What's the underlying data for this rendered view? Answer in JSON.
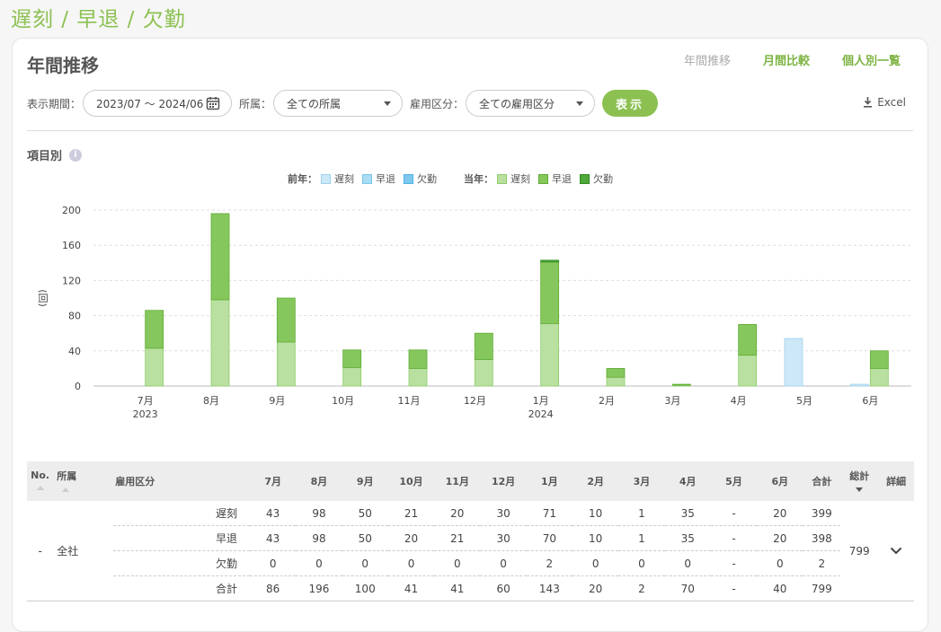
{
  "breadcrumb": "遅刻 / 早退 / 欠勤",
  "page_title": "年間推移",
  "view_tabs": [
    "年間推移",
    "月間比較",
    "個人別一覧"
  ],
  "filters": {
    "period_label": "表示期間：",
    "period_value": "2023/07 ～ 2024/06",
    "dept_label": "所属：",
    "dept_value": "全ての所属",
    "emp_label": "雇用区分：",
    "emp_value": "全ての雇用区分",
    "show_button": "表示",
    "excel": "Excel"
  },
  "section_title": "項目別",
  "legend": {
    "prev_label": "前年：",
    "curr_label": "当年：",
    "items": [
      "遅刻",
      "早退",
      "欠勤"
    ]
  },
  "colors": {
    "prev": [
      "#cde8f7",
      "#a9dbf3",
      "#7ec8ee"
    ],
    "curr": [
      "#b9e0a0",
      "#86c75d",
      "#4fa83a"
    ],
    "accent": "#8cc152"
  },
  "chart_data": {
    "type": "bar",
    "stacked": true,
    "categories": [
      "7月",
      "8月",
      "9月",
      "10月",
      "11月",
      "12月",
      "1月",
      "2月",
      "3月",
      "4月",
      "5月",
      "6月"
    ],
    "year_labels": {
      "0": "2023",
      "6": "2024"
    },
    "ylabel": "(回)",
    "ylim": [
      0,
      200
    ],
    "yticks": [
      0,
      40,
      80,
      120,
      160,
      200
    ],
    "grid": true,
    "series": [
      {
        "name": "遅刻",
        "group": "前年",
        "values": [
          0,
          0,
          0,
          0,
          0,
          0,
          0,
          0,
          0,
          0,
          54,
          2
        ]
      },
      {
        "name": "早退",
        "group": "前年",
        "values": [
          0,
          0,
          0,
          0,
          0,
          0,
          0,
          0,
          0,
          0,
          0,
          0
        ]
      },
      {
        "name": "欠勤",
        "group": "前年",
        "values": [
          0,
          0,
          0,
          0,
          0,
          0,
          0,
          0,
          0,
          0,
          0,
          0
        ]
      },
      {
        "name": "遅刻",
        "group": "当年",
        "values": [
          43,
          98,
          50,
          21,
          20,
          30,
          71,
          10,
          1,
          35,
          0,
          20
        ]
      },
      {
        "name": "早退",
        "group": "当年",
        "values": [
          43,
          98,
          50,
          20,
          21,
          30,
          70,
          10,
          1,
          35,
          0,
          20
        ]
      },
      {
        "name": "欠勤",
        "group": "当年",
        "values": [
          0,
          0,
          0,
          0,
          0,
          0,
          2,
          0,
          0,
          0,
          0,
          0
        ]
      }
    ]
  },
  "table": {
    "headers": {
      "no": "No.",
      "dept": "所属",
      "emp": "雇用区分",
      "total": "合計",
      "grand": "総計",
      "detail": "詳細"
    },
    "months": [
      "7月",
      "8月",
      "9月",
      "10月",
      "11月",
      "12月",
      "1月",
      "2月",
      "3月",
      "4月",
      "5月",
      "6月"
    ],
    "row": {
      "no": "-",
      "dept": "全社",
      "grand_total": "799",
      "items": [
        {
          "label": "遅刻",
          "values": [
            "43",
            "98",
            "50",
            "21",
            "20",
            "30",
            "71",
            "10",
            "1",
            "35",
            "-",
            "20"
          ],
          "total": "399"
        },
        {
          "label": "早退",
          "values": [
            "43",
            "98",
            "50",
            "20",
            "21",
            "30",
            "70",
            "10",
            "1",
            "35",
            "-",
            "20"
          ],
          "total": "398"
        },
        {
          "label": "欠勤",
          "values": [
            "0",
            "0",
            "0",
            "0",
            "0",
            "0",
            "2",
            "0",
            "0",
            "0",
            "-",
            "0"
          ],
          "total": "2"
        },
        {
          "label": "合計",
          "values": [
            "86",
            "196",
            "100",
            "41",
            "41",
            "60",
            "143",
            "20",
            "2",
            "70",
            "-",
            "40"
          ],
          "total": "799"
        }
      ]
    }
  }
}
